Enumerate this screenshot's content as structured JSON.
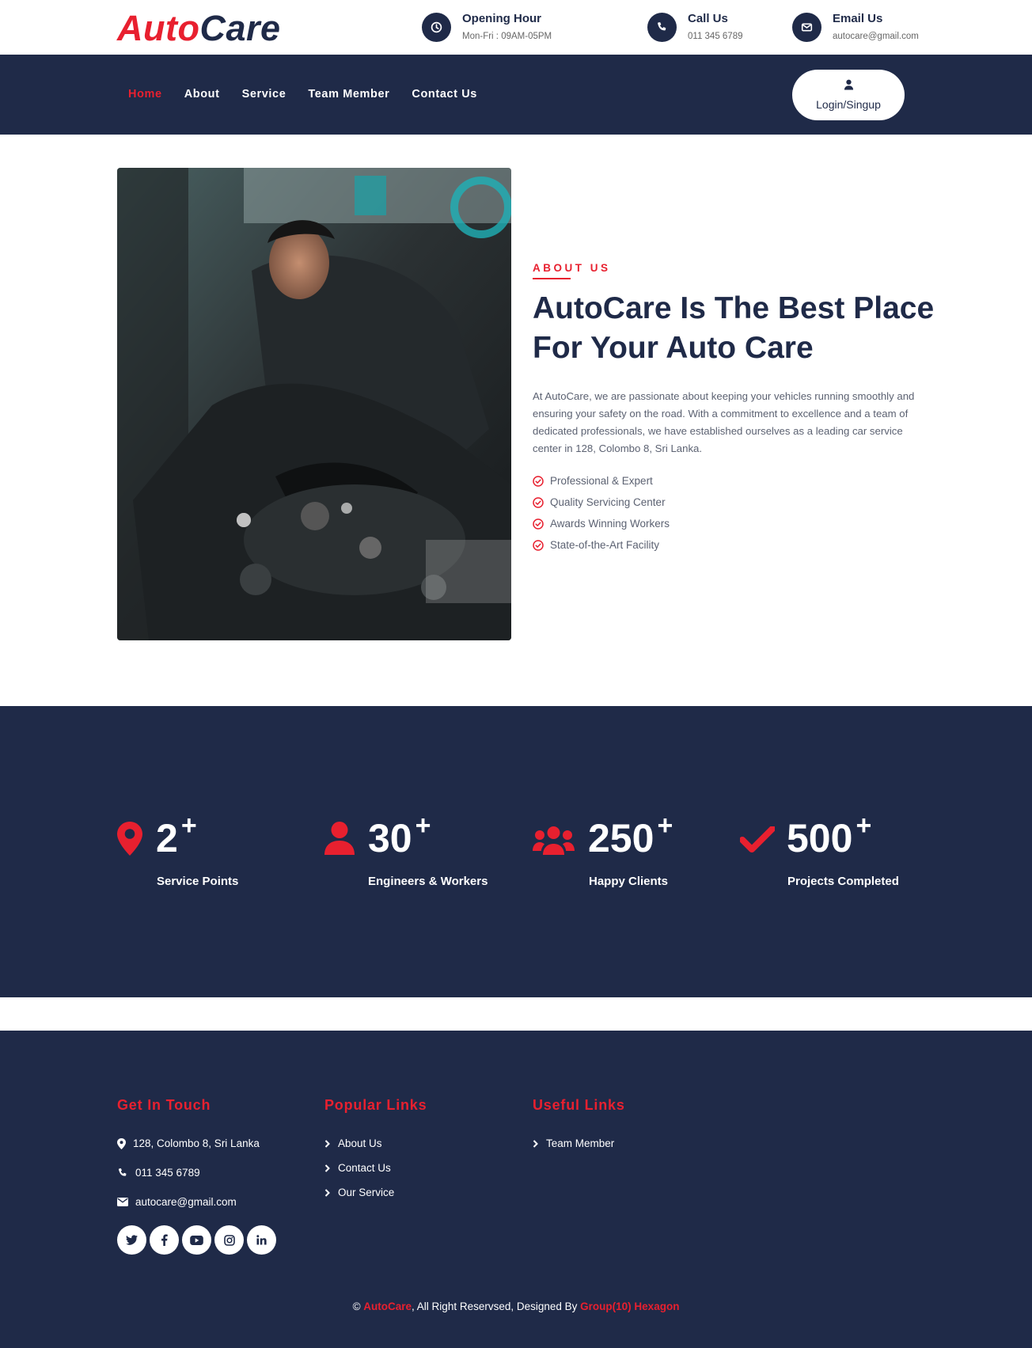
{
  "brand": {
    "name_part1": "Auto",
    "name_part2": "Care",
    "accent_color": "#e8202f",
    "primary_color": "#1f2a48"
  },
  "topbar": {
    "contacts": [
      {
        "icon": "clock-icon",
        "title": "Opening Hour",
        "detail": "Mon-Fri : 09AM-05PM"
      },
      {
        "icon": "phone-icon",
        "title": "Call Us",
        "detail": "011 345 6789"
      },
      {
        "icon": "envelope-icon",
        "title": "Email Us",
        "detail": "autocare@gmail.com"
      }
    ]
  },
  "nav": {
    "links": [
      "Home",
      "About",
      "Service",
      "Team Member",
      "Contact Us"
    ],
    "active": "Home",
    "login_label": "Login/Singup"
  },
  "about": {
    "eyebrow": "ABOUT US",
    "title": "AutoCare Is The Best Place For Your Auto Care",
    "text": "At AutoCare, we are passionate about keeping your vehicles running smoothly and ensuring your safety on the road. With a commitment to excellence and a team of dedicated professionals, we have established ourselves as a leading car service center in 128, Colombo 8, Sri Lanka.",
    "features": [
      "Professional & Expert",
      "Quality Servicing Center",
      "Awards Winning Workers",
      "State-of-the-Art Facility"
    ]
  },
  "stats": [
    {
      "icon": "map-marker-icon",
      "value": "2",
      "suffix": "+",
      "label": "Service Points"
    },
    {
      "icon": "user-icon",
      "value": "30",
      "suffix": "+",
      "label": "Engineers & Workers"
    },
    {
      "icon": "users-icon",
      "value": "250",
      "suffix": "+",
      "label": "Happy Clients"
    },
    {
      "icon": "check-icon",
      "value": "500",
      "suffix": "+",
      "label": "Projects Completed"
    }
  ],
  "footer": {
    "get_in_touch": {
      "title": "Get In Touch",
      "address": "128, Colombo 8, Sri Lanka",
      "phone": "011 345 6789",
      "email": "autocare@gmail.com"
    },
    "popular_links": {
      "title": "Popular Links",
      "links": [
        "About Us",
        "Contact Us",
        "Our Service"
      ]
    },
    "useful_links": {
      "title": "Useful Links",
      "links": [
        "Team Member"
      ]
    },
    "socials": [
      "twitter-icon",
      "facebook-icon",
      "youtube-icon",
      "instagram-icon",
      "linkedin-icon"
    ],
    "copyright": {
      "prefix": "©",
      "brand": "AutoCare",
      "middle": ", All Right Reservsed, Designed By",
      "designer": "Group(10) Hexagon"
    }
  }
}
